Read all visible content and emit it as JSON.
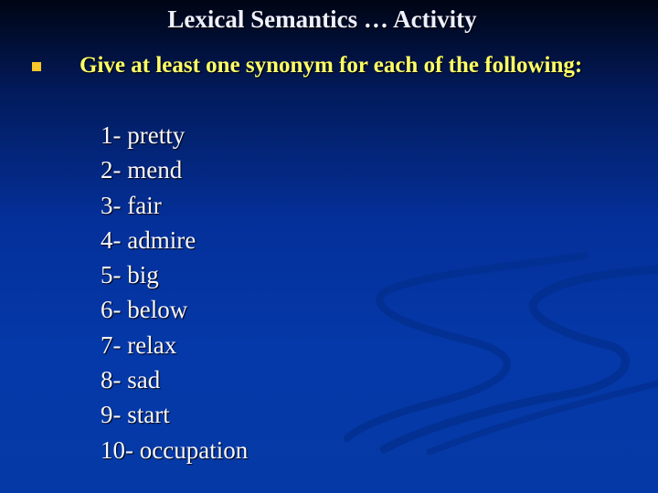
{
  "slide": {
    "title": "Lexical Semantics … Activity",
    "bullet": "Give at least one synonym for each of the following:",
    "items": [
      "1- pretty",
      "2- mend",
      "3- fair",
      "4- admire",
      "5- big",
      "6- below",
      "7- relax",
      "8- sad",
      "9- start",
      "10- occupation"
    ]
  }
}
